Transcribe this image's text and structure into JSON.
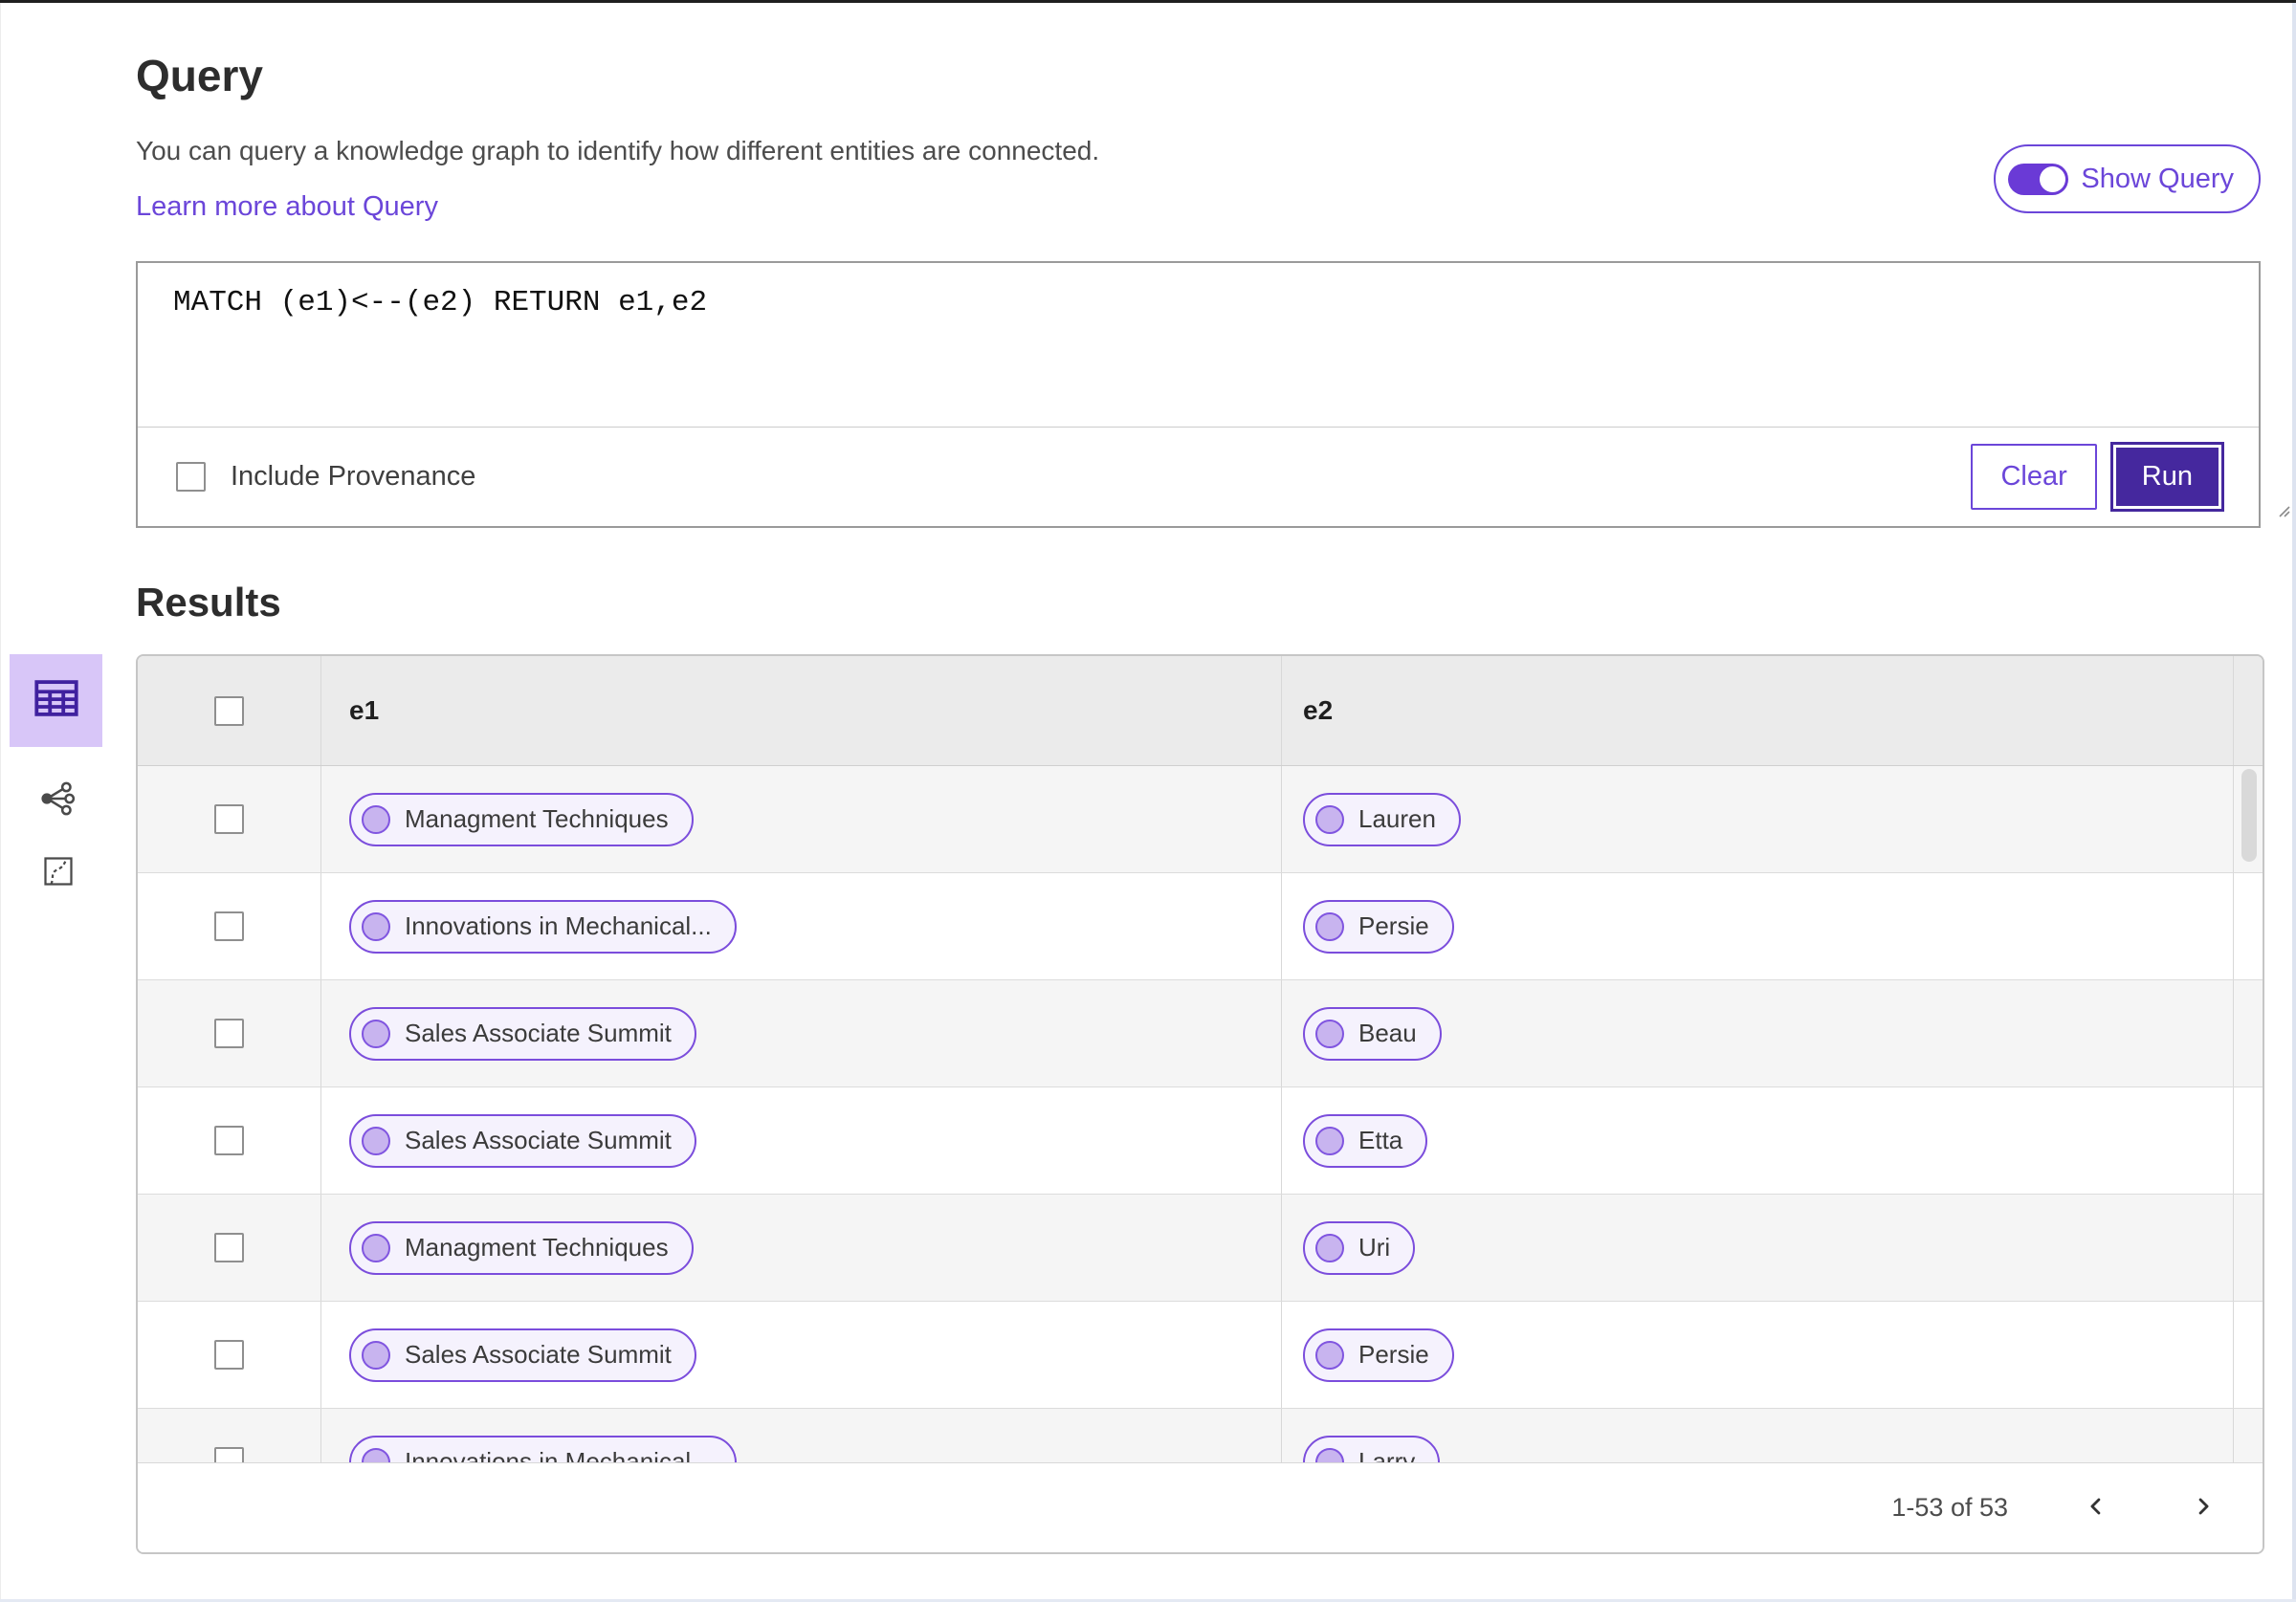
{
  "header": {
    "title": "Query",
    "description": "You can query a knowledge graph to identify how different entities are connected.",
    "learn_more_label": "Learn more about Query",
    "show_query_label": "Show Query",
    "show_query_state": "on"
  },
  "query_panel": {
    "query_text": "MATCH (e1)<--(e2) RETURN e1,e2",
    "include_provenance_label": "Include Provenance",
    "include_provenance_checked": false,
    "clear_label": "Clear",
    "run_label": "Run"
  },
  "results": {
    "title": "Results",
    "views": [
      {
        "name": "table-view",
        "icon": "table-icon",
        "selected": true
      },
      {
        "name": "network-view",
        "icon": "network-icon",
        "selected": false
      },
      {
        "name": "map-view",
        "icon": "map-icon",
        "selected": false
      }
    ]
  },
  "table": {
    "columns": [
      "e1",
      "e2"
    ],
    "rows": [
      {
        "e1": "Managment Techniques",
        "e2": "Lauren"
      },
      {
        "e1": "Innovations in Mechanical...",
        "e2": "Persie"
      },
      {
        "e1": "Sales Associate Summit",
        "e2": "Beau"
      },
      {
        "e1": "Sales Associate Summit",
        "e2": "Etta"
      },
      {
        "e1": "Managment Techniques",
        "e2": "Uri"
      },
      {
        "e1": "Sales Associate Summit",
        "e2": "Persie"
      },
      {
        "e1": "Innovations in Mechanical...",
        "e2": "Larry"
      }
    ]
  },
  "pagination": {
    "range_text": "1-53 of 53",
    "prev_icon": "chevron-left-icon",
    "next_icon": "chevron-right-icon"
  },
  "colors": {
    "accent_purple": "#6B46D9",
    "dark_purple": "#45289E",
    "toggle_track": "#6A3AD6",
    "pill_border": "#7B4DDC",
    "pill_background": "#F5F2FD",
    "avatar_fill": "#C8B4EF",
    "selected_tile_background": "#D8C6F8",
    "table_header_background": "#EBEBEB",
    "row_alternate_background": "#F5F5F5"
  }
}
